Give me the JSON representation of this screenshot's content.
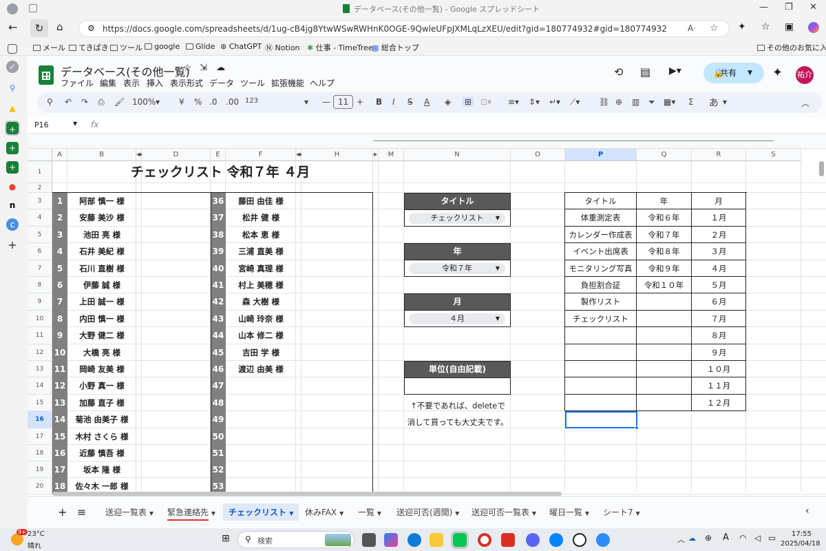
{
  "browser": {
    "tab_title": "データベース(その他一覧) - Google スプレッドシート",
    "url": "https://docs.google.com/spreadsheets/d/1ug-cB4jg8YtwWSwRWHnK0OGE-9QwleUFpJXMLqLzXEU/edit?gid=180774932#gid=180774932",
    "bookmarks": [
      "メール",
      "てきぱき",
      "ツール",
      "google",
      "Glide",
      "ChatGPT",
      "Notion",
      "仕事 - TimeTree",
      "総合トップ"
    ],
    "other_bookmarks": "その他のお気に入り"
  },
  "doc": {
    "title": "データベース(その他一覧)",
    "menus": [
      "ファイル",
      "編集",
      "表示",
      "挿入",
      "表示形式",
      "データ",
      "ツール",
      "拡張機能",
      "ヘルプ"
    ],
    "share_label": "共有",
    "avatar": "祐介"
  },
  "toolbar": {
    "zoom": "100%",
    "currency": "¥",
    "percent": "%",
    "dec_dec": ".0",
    "dec_inc": ".00",
    "format123": "123",
    "font_size": "11",
    "input_mode": "あ"
  },
  "formula_bar": {
    "cell_ref": "P16",
    "fx": "fx"
  },
  "columns": [
    "A",
    "B",
    "",
    "D",
    "E",
    "F",
    "",
    "H",
    "",
    "M",
    "N",
    "O",
    "P",
    "Q",
    "R",
    "S"
  ],
  "rows": [
    "1",
    "2",
    "3",
    "4",
    "5",
    "6",
    "7",
    "8",
    "9",
    "10",
    "11",
    "12",
    "13",
    "14",
    "15",
    "16",
    "17",
    "18",
    "19",
    "20"
  ],
  "sheet": {
    "heading": "チェックリスト 令和７年 ４月",
    "list1": [
      {
        "n": "1",
        "name": "阿部 慎一 様"
      },
      {
        "n": "2",
        "name": "安藤 美沙 様"
      },
      {
        "n": "3",
        "name": "池田 亮 様"
      },
      {
        "n": "4",
        "name": "石井 美紀 様"
      },
      {
        "n": "5",
        "name": "石川 直樹 様"
      },
      {
        "n": "6",
        "name": "伊藤 誠 様"
      },
      {
        "n": "7",
        "name": "上田 誠一 様"
      },
      {
        "n": "8",
        "name": "内田 慎一 様"
      },
      {
        "n": "9",
        "name": "大野 健二 様"
      },
      {
        "n": "10",
        "name": "大橋 亮 様"
      },
      {
        "n": "11",
        "name": "岡崎 友美 様"
      },
      {
        "n": "12",
        "name": "小野 真一 様"
      },
      {
        "n": "13",
        "name": "加藤 直子 様"
      },
      {
        "n": "14",
        "name": "菊池 由美子 様"
      },
      {
        "n": "15",
        "name": "木村 さくら 様"
      },
      {
        "n": "16",
        "name": "近藤 慎吾 様"
      },
      {
        "n": "17",
        "name": "坂本 隆 様"
      },
      {
        "n": "18",
        "name": "佐々木 一郎 様"
      }
    ],
    "list2": [
      {
        "n": "36",
        "name": "藤田 由佳 様"
      },
      {
        "n": "37",
        "name": "松井 健 様"
      },
      {
        "n": "38",
        "name": "松本 恵 様"
      },
      {
        "n": "39",
        "name": "三浦 直美 様"
      },
      {
        "n": "40",
        "name": "宮崎 真理 様"
      },
      {
        "n": "41",
        "name": "村上 美穂 様"
      },
      {
        "n": "42",
        "name": "森 大樹 様"
      },
      {
        "n": "43",
        "name": "山崎 玲奈 様"
      },
      {
        "n": "44",
        "name": "山本 修二 様"
      },
      {
        "n": "45",
        "name": "吉田 学 様"
      },
      {
        "n": "46",
        "name": "渡辺 由美 様"
      },
      {
        "n": "47",
        "name": ""
      },
      {
        "n": "48",
        "name": ""
      },
      {
        "n": "49",
        "name": ""
      },
      {
        "n": "50",
        "name": ""
      },
      {
        "n": "51",
        "name": ""
      },
      {
        "n": "52",
        "name": ""
      },
      {
        "n": "53",
        "name": ""
      }
    ],
    "panel": {
      "title_label": "タイトル",
      "title_value": "チェックリスト",
      "year_label": "年",
      "year_value": "令和７年",
      "month_label": "月",
      "month_value": "４月",
      "unit_label": "単位(自由記載)",
      "note1": "↑不要であれば、deleteで",
      "note2": "消して貰っても大丈夫です。"
    },
    "lookup": {
      "headers": [
        "タイトル",
        "年",
        "月"
      ],
      "titles": [
        "体重測定表",
        "カレンダー作成表",
        "イベント出席表",
        "モニタリング写真",
        "負担割合証",
        "製作リスト",
        "チェックリスト",
        "",
        "",
        "",
        "",
        ""
      ],
      "years": [
        "令和６年",
        "令和７年",
        "令和８年",
        "令和９年",
        "令和１０年",
        "",
        "",
        "",
        "",
        "",
        "",
        ""
      ],
      "months": [
        "１月",
        "２月",
        "３月",
        "４月",
        "５月",
        "６月",
        "７月",
        "８月",
        "９月",
        "１０月",
        "１１月",
        "１２月"
      ]
    }
  },
  "tabs": [
    "送迎一覧表",
    "緊急連絡先",
    "チェックリスト",
    "休みFAX",
    "一覧",
    "送迎可否(週間)",
    "送迎可否一覧表",
    "曜日一覧",
    "シート7"
  ],
  "taskbar": {
    "temp": "23°C",
    "weather": "晴れ",
    "badge": "9+",
    "search": "検索",
    "time": "17:55",
    "date": "2025/04/18",
    "ime": "A"
  }
}
